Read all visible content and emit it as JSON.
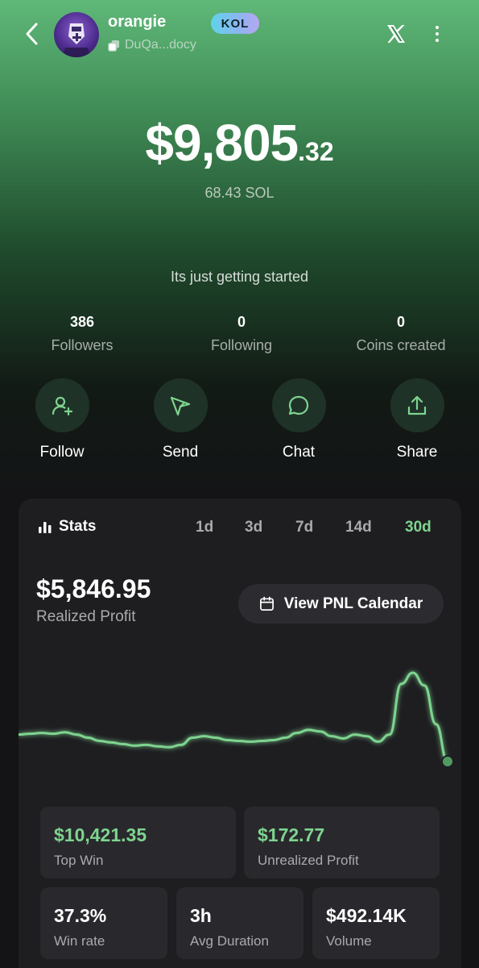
{
  "header": {
    "username": "orangie",
    "wallet_short": "DuQa...docy",
    "badge": "KOL",
    "icons": {
      "back": "chevron-left-icon",
      "x": "x-logo-icon",
      "more": "more-vertical-icon",
      "copy": "copy-icon"
    }
  },
  "balance": {
    "usd_main": "$9,805",
    "usd_cents": ".32",
    "sol": "68.43 SOL"
  },
  "bio": "Its just getting started",
  "social": [
    {
      "count": "386",
      "label": "Followers"
    },
    {
      "count": "0",
      "label": "Following"
    },
    {
      "count": "0",
      "label": "Coins created"
    }
  ],
  "actions": [
    {
      "label": "Follow",
      "icon": "user-plus-icon"
    },
    {
      "label": "Send",
      "icon": "send-icon"
    },
    {
      "label": "Chat",
      "icon": "chat-bubble-icon"
    },
    {
      "label": "Share",
      "icon": "share-upload-icon"
    }
  ],
  "stats": {
    "title": "Stats",
    "ranges": [
      "1d",
      "3d",
      "7d",
      "14d",
      "30d"
    ],
    "active_range": "30d",
    "realized_profit": "$5,846.95",
    "realized_profit_label": "Realized Profit",
    "pnl_button": "View PNL Calendar",
    "top_win": "$10,421.35",
    "top_win_label": "Top Win",
    "unrealized_profit": "$172.77",
    "unrealized_profit_label": "Unrealized Profit",
    "win_rate": "37.3%",
    "win_rate_label": "Win rate",
    "avg_duration": "3h",
    "avg_duration_label": "Avg Duration",
    "volume": "$492.14K",
    "volume_label": "Volume"
  },
  "colors": {
    "accent_green": "#7ed48f",
    "card_bg": "#1e1e21",
    "tile_bg": "#29292d",
    "badge_gradient_start": "#5fd3e8",
    "badge_gradient_end": "#b7a6f2"
  },
  "chart_data": {
    "type": "line",
    "series": [
      {
        "values": [
          0.22,
          0.23,
          0.24,
          0.23,
          0.25,
          0.22,
          0.18,
          0.14,
          0.12,
          0.1,
          0.08,
          0.09,
          0.07,
          0.06,
          0.09,
          0.18,
          0.2,
          0.18,
          0.15,
          0.14,
          0.13,
          0.14,
          0.15,
          0.18,
          0.24,
          0.28,
          0.26,
          0.2,
          0.17,
          0.22,
          0.2,
          0.13,
          0.22,
          0.86,
          1.0,
          0.84,
          0.35,
          -0.12
        ]
      }
    ]
  }
}
